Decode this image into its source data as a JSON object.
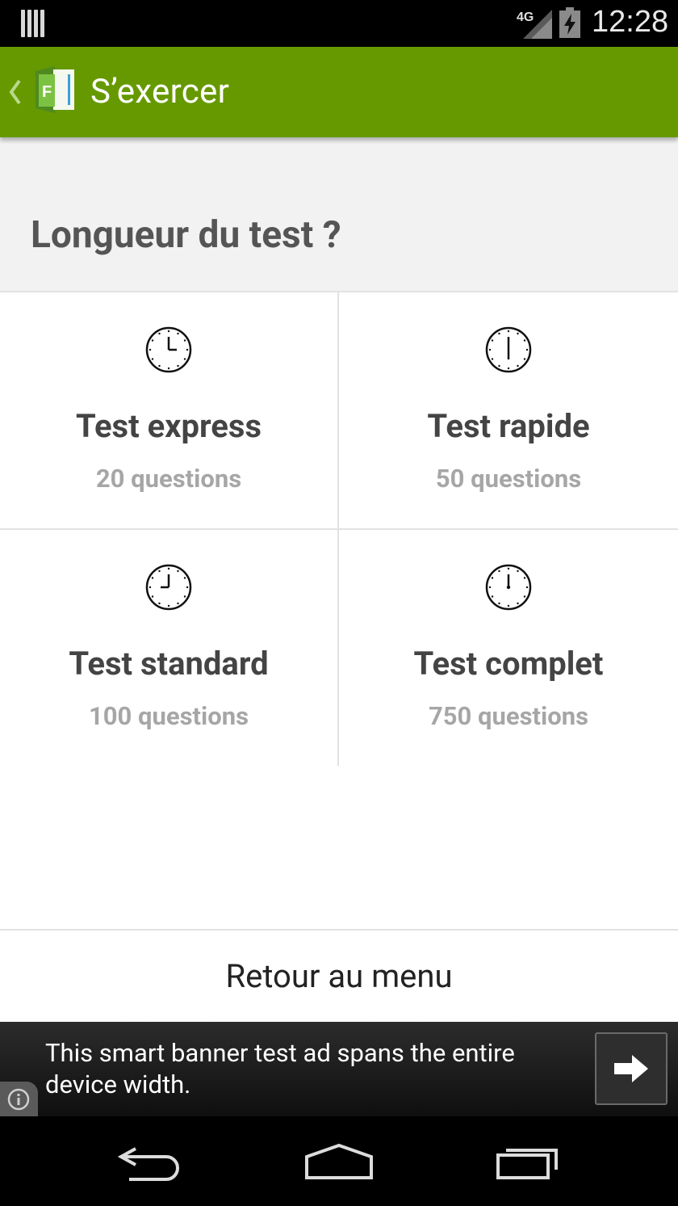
{
  "status_bar": {
    "network_label": "4G",
    "time": "12:28",
    "icons": [
      "notification-bars-icon",
      "signal-icon",
      "battery-charging-icon"
    ]
  },
  "action_bar": {
    "title": "S’exercer",
    "logo_letter": "F",
    "color": "#669900",
    "icons": [
      "up-chevron-icon",
      "app-logo-icon"
    ]
  },
  "header": {
    "title": "Longueur du test ?"
  },
  "tests": [
    {
      "name": "Test express",
      "questions": "20 questions",
      "icon": "clock-icon"
    },
    {
      "name": "Test rapide",
      "questions": "50 questions",
      "icon": "clock-icon"
    },
    {
      "name": "Test standard",
      "questions": "100 questions",
      "icon": "clock-icon"
    },
    {
      "name": "Test complet",
      "questions": "750 questions",
      "icon": "clock-icon"
    }
  ],
  "back_button": {
    "label": "Retour au menu"
  },
  "ad_banner": {
    "text": "This smart banner test ad spans the entire device width.",
    "icons": [
      "arrow-right-icon",
      "info-icon"
    ]
  },
  "nav_bar": {
    "icons": [
      "back-icon",
      "home-icon",
      "recents-icon"
    ]
  }
}
